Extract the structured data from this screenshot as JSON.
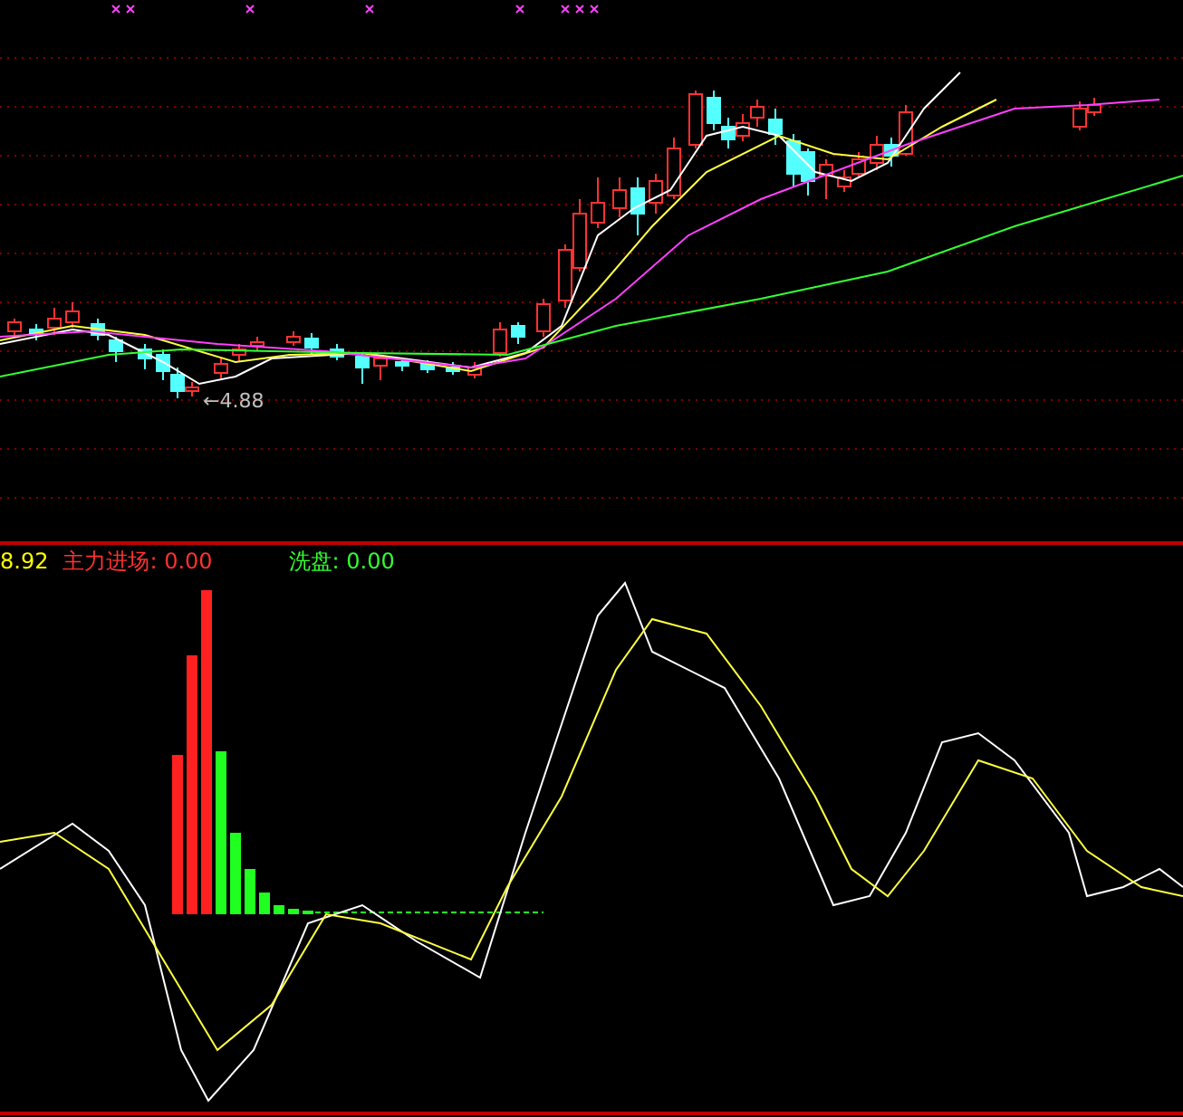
{
  "price_panel": {
    "low_marker": "←4.88"
  },
  "indicator_panel": {
    "legend": [
      {
        "text": "8.92",
        "color": "#ffff00"
      },
      {
        "text": "主力进场: 0.00",
        "color": "#ff3232"
      },
      {
        "text": "洗盘: 0.00",
        "color": "#33ff33"
      }
    ]
  }
}
